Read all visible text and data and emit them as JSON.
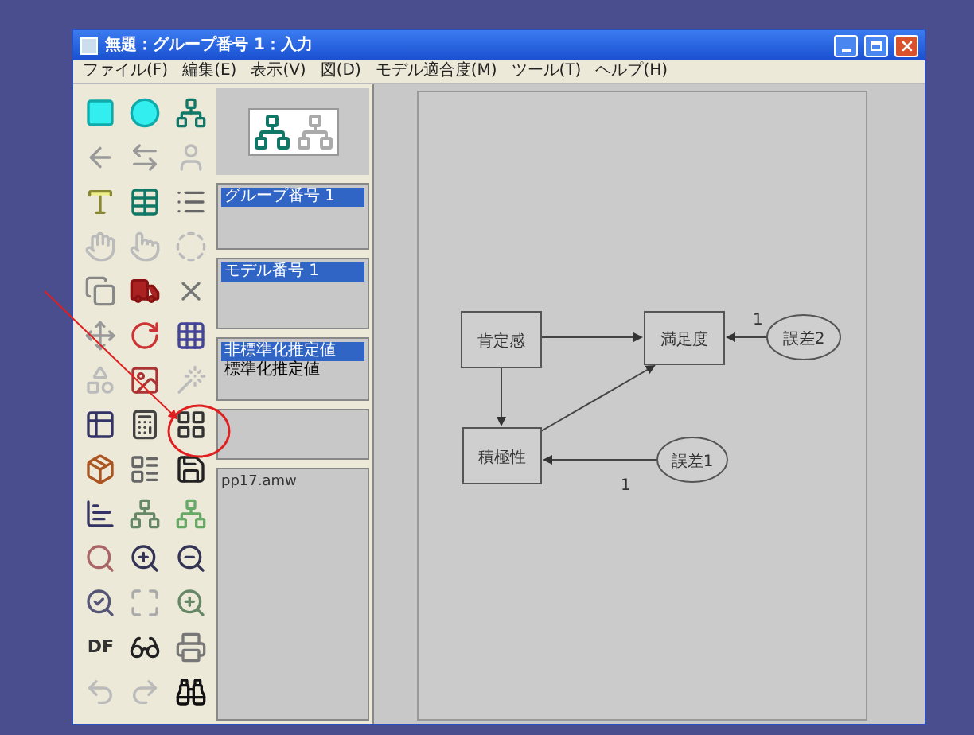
{
  "window": {
    "title": "無題：グループ番号 1：入力"
  },
  "menu": [
    "ファイル(F)",
    "編集(E)",
    "表示(V)",
    "図(D)",
    "モデル適合度(M)",
    "ツール(T)",
    "ヘルプ(H)"
  ],
  "toolbar": {
    "df_label": "DF"
  },
  "groups_panel": {
    "items": [
      {
        "label": "グループ番号 1",
        "selected": true
      }
    ]
  },
  "models_panel": {
    "items": [
      {
        "label": "モデル番号 1",
        "selected": true
      }
    ]
  },
  "estimates_panel": {
    "items": [
      {
        "label": "非標準化推定値",
        "selected": true
      },
      {
        "label": "標準化推定値",
        "selected": false
      }
    ]
  },
  "files_panel": {
    "items": [
      "pp17.amw"
    ]
  },
  "diagram": {
    "nodes": [
      {
        "kind": "observed",
        "label": "肯定感"
      },
      {
        "kind": "observed",
        "label": "満足度"
      },
      {
        "kind": "error",
        "label": "誤差2"
      },
      {
        "kind": "observed",
        "label": "積極性"
      },
      {
        "kind": "error",
        "label": "誤差1"
      }
    ],
    "path_labels": [
      "1",
      "1"
    ]
  }
}
